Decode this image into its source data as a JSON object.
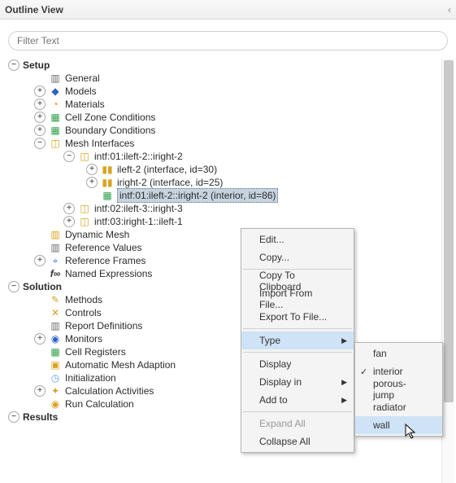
{
  "title": "Outline View",
  "filter_placeholder": "Filter Text",
  "tree": {
    "setup": "Setup",
    "general": "General",
    "models": "Models",
    "materials": "Materials",
    "cellzone": "Cell Zone Conditions",
    "boundary": "Boundary Conditions",
    "mesh_if": "Mesh Interfaces",
    "intf01": "intf:01:ileft-2::iright-2",
    "ileft2": "ileft-2 (interface, id=30)",
    "iright2": "iright-2 (interface, id=25)",
    "intf01b": "intf:01:ileft-2::iright-2 (interior, id=86)",
    "intf02": "intf:02:ileft-3::iright-3",
    "intf03": "intf:03:iright-1::ileft-1",
    "dynmesh": "Dynamic Mesh",
    "refvals": "Reference Values",
    "refframes": "Reference Frames",
    "namedexpr": "Named Expressions",
    "solution": "Solution",
    "methods": "Methods",
    "controls": "Controls",
    "reportdef": "Report Definitions",
    "monitors": "Monitors",
    "cellreg": "Cell Registers",
    "autoadapt": "Automatic Mesh Adaption",
    "init": "Initialization",
    "calcact": "Calculation Activities",
    "runcalc": "Run Calculation",
    "results": "Results"
  },
  "menu": {
    "edit": "Edit...",
    "copy": "Copy...",
    "copycb": "Copy To Clipboard",
    "import": "Import From File...",
    "export": "Export To File...",
    "type": "Type",
    "display": "Display",
    "displayin": "Display in",
    "addto": "Add to",
    "expand": "Expand All",
    "collapse": "Collapse All"
  },
  "submenu": {
    "fan": "fan",
    "interior": "interior",
    "porous": "porous-jump",
    "radiator": "radiator",
    "wall": "wall"
  }
}
